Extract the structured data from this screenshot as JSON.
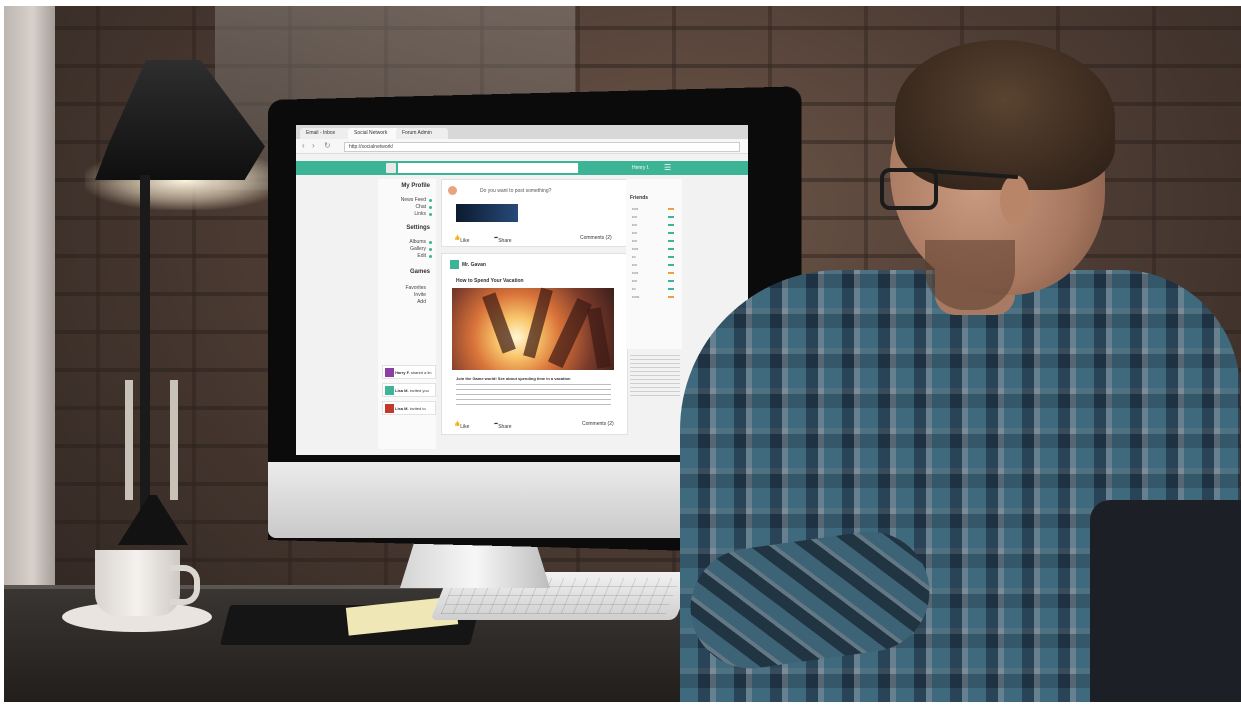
{
  "browser": {
    "tabs": [
      {
        "label": "Email - Inbox"
      },
      {
        "label": "Social Network"
      },
      {
        "label": "Forum Admin"
      }
    ],
    "address": "http://socialnetwork/"
  },
  "app": {
    "accent_color": "#3db495",
    "user_name": "Henry I.",
    "left_panel": {
      "profile_heading": "My Profile",
      "profile_items": [
        "News Feed",
        "Chat",
        "Links"
      ],
      "settings_heading": "Settings",
      "settings_items": [
        "Albums",
        "Gallery",
        "Edit"
      ],
      "games_heading": "Games",
      "games_items": [
        "Favorites",
        "Invite",
        "Add"
      ],
      "messages": [
        {
          "name": "Harry F.",
          "text": "shared a lin"
        },
        {
          "name": "Lisa M.",
          "text": "invited you"
        },
        {
          "name": "Lisa M.",
          "text": "invited to"
        }
      ]
    },
    "composer": {
      "prompt": "Do you want to post something?",
      "like_label": "Like",
      "share_label": "Share",
      "comments_label": "Comments (2)"
    },
    "post": {
      "author": "Mr. Gavan",
      "title": "How to Spend Your Vacation",
      "subtitle": "Join the Game world! See about spending time in a vacation",
      "like_label": "Like",
      "share_label": "Share",
      "comments_label": "Comments (2)"
    },
    "right_panel": {
      "friends_heading": "Friends"
    }
  }
}
